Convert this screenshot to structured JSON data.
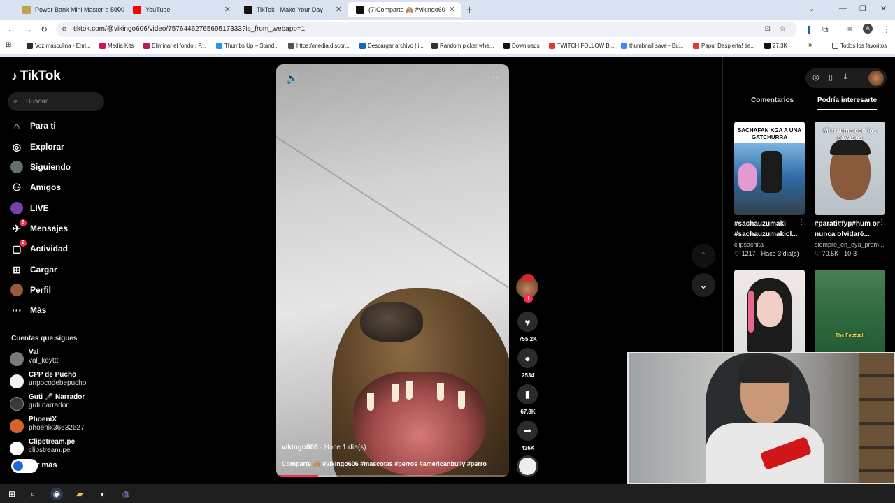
{
  "browser": {
    "tabs": [
      {
        "title": "Power Bank Mini Master-g 5000",
        "color": "#c59d55"
      },
      {
        "title": "YouTube",
        "color": "#ff0000"
      },
      {
        "title": "TikTok - Make Your Day",
        "color": "#111111"
      },
      {
        "title": "(7)Comparte 🙈 #vikingo60",
        "color": "#111111"
      }
    ],
    "url": "tiktok.com/@vikingo606/video/7576446276569517333?is_from_webapp=1",
    "bookmarks": [
      {
        "label": "Voz masculina - Enri...",
        "color": "#2b2b2b"
      },
      {
        "label": "Media Kits",
        "color": "#d4145a"
      },
      {
        "label": "Eliminar el fondo : P...",
        "color": "#c2185b"
      },
      {
        "label": "Thumbs Up – Stand...",
        "color": "#2196f3"
      },
      {
        "label": "https://media.discor...",
        "color": "#555555"
      },
      {
        "label": "Descargar archivo | i...",
        "color": "#1565c0"
      },
      {
        "label": "Random picker whe...",
        "color": "#333333"
      },
      {
        "label": "Downloads",
        "color": "#111111"
      },
      {
        "label": "TWITCH FOLLOW B...",
        "color": "#e53935"
      },
      {
        "label": "thumbnail save - Bu...",
        "color": "#4285f4"
      },
      {
        "label": "Papu! Despierta! tie...",
        "color": "#e53935"
      },
      {
        "label": "27.3K",
        "color": "#111111"
      }
    ],
    "bookmarks_folder": "Todos los favoritos"
  },
  "sidebar": {
    "logo": "TikTok",
    "search_placeholder": "Buscar",
    "items": [
      {
        "label": "Para ti",
        "icon": "home-icon",
        "glyph": "⌂"
      },
      {
        "label": "Explorar",
        "icon": "compass-icon",
        "glyph": "◎"
      },
      {
        "label": "Siguiendo",
        "icon": "following-avatar-icon",
        "glyph": "●"
      },
      {
        "label": "Amigos",
        "icon": "friends-icon",
        "glyph": "⚇"
      },
      {
        "label": "LIVE",
        "icon": "live-avatar-icon",
        "glyph": "●"
      },
      {
        "label": "Mensajes",
        "icon": "messages-icon",
        "glyph": "✈",
        "badge": "5"
      },
      {
        "label": "Actividad",
        "icon": "activity-icon",
        "glyph": "▢",
        "badge": "2"
      },
      {
        "label": "Cargar",
        "icon": "upload-icon",
        "glyph": "⊞"
      },
      {
        "label": "Perfil",
        "icon": "profile-avatar-icon",
        "glyph": "●"
      },
      {
        "label": "Más",
        "icon": "more-icon",
        "glyph": "···"
      }
    ],
    "following_title": "Cuentas que sigues",
    "following": [
      {
        "name": "Val",
        "handle": "val_keyttt",
        "color": "#7a7a7a"
      },
      {
        "name": "CPP de Pucho",
        "handle": "unpocodebepucho",
        "color": "#f2f2f2"
      },
      {
        "name": "Guti 🎤 Narrador",
        "handle": "guti.narrador",
        "color": "#3a3a3a"
      },
      {
        "name": "PhoeniX",
        "handle": "phoenix36632627",
        "color": "#d4622b"
      },
      {
        "name": "Clipstream.pe",
        "handle": "clipstream.pe",
        "color": "#ffffff"
      }
    ],
    "see_more": "er más"
  },
  "video": {
    "author": "vikingo606",
    "when": " · Hace 1 día(s)",
    "caption": "Comparte 🙈 #vikingo606 #mascotas #perros #americanbully #perro",
    "progress": 0.18
  },
  "actions": {
    "likes": "755.2K",
    "comments": "2534",
    "saves": "67.8K",
    "shares": "436K"
  },
  "right_panel": {
    "tabs": [
      "Comentarios",
      "Podría interesarte"
    ],
    "cards": [
      {
        "caption": "SACHAFAN KGA A UNA GATCHURRA",
        "title": "#sachauzumaki #sachauzumakicl...",
        "author": "clipsachita",
        "likes": "1217",
        "date": "Hace 3 día(s)"
      },
      {
        "caption": "Mi trauma con los payasos",
        "title": "#parati#fyp#hum or nunca olvidaré...",
        "author": "siempre_en_oya_prem...",
        "likes": "70.5K",
        "date": "10-3"
      },
      {
        "caption": "",
        "title": "",
        "author": "",
        "likes": "",
        "date": ""
      },
      {
        "caption": "The Football",
        "title": "",
        "author": "",
        "likes": "",
        "date": ""
      }
    ]
  },
  "colors": {
    "accent": "#fe2c55",
    "background": "#000000"
  }
}
